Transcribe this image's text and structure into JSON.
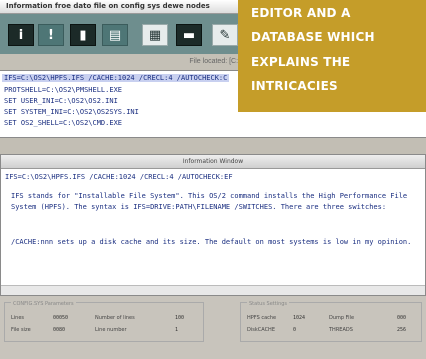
{
  "window": {
    "title": "Information froe dato file on config sys dewe nodes"
  },
  "toolbar": {
    "buttons": [
      {
        "icon": "info-icon",
        "glyph": "i"
      },
      {
        "icon": "exclamation-icon",
        "glyph": "!"
      },
      {
        "icon": "page-arrow-icon",
        "glyph": "▮"
      },
      {
        "icon": "clipboard-icon",
        "glyph": "▤"
      },
      {
        "icon": "grid-icon",
        "glyph": "▦"
      },
      {
        "icon": "list-icon",
        "glyph": "▬"
      },
      {
        "icon": "edit-icon",
        "glyph": "✎"
      }
    ]
  },
  "location": {
    "label": "File located: [C:\\"
  },
  "file_pane": {
    "lines": [
      "IFS=C:\\OS2\\HPFS.IFS /CACHE:1024 /CRECL:4 /AUTOCHECK:C",
      "PROTSHELL=C:\\OS2\\PMSHELL.EXE",
      "SET USER_INI=C:\\OS2\\OS2.INI",
      "SET SYSTEM_INI=C:\\OS2\\OS2SYS.INI",
      "SET OS2_SHELL=C:\\OS2\\CMD.EXE"
    ]
  },
  "info": {
    "title": "Information Window",
    "path": "IFS=C:\\OS2\\HPFS.IFS /CACHE:1024 /CRECL:4 /AUTOCHECK:EF",
    "paragraphs": [
      "IFS stands for \"Installable File System\". This OS/2 command installs the High Performance File System (HPFS). The syntax is IFS=DRIVE:PATH\\FILENAME /SWITCHES. There are three switches:",
      "/CACHE:nnn sets up a disk cache and its size. The default on most systems is low in my opinion."
    ]
  },
  "status": {
    "group1": {
      "title": "CONFIG.SYS Parameters",
      "fields": [
        {
          "label": "Lines",
          "value": "00050"
        },
        {
          "label": "Number of lines",
          "value": "100"
        },
        {
          "label": "File size",
          "value": "0080"
        },
        {
          "label": "Line number",
          "value": "1"
        }
      ]
    },
    "group2": {
      "title": "Status Settings",
      "fields": [
        {
          "label": "HPFS cache",
          "value": "1024"
        },
        {
          "label": "DiskCACHE",
          "value": "0"
        },
        {
          "label": "Dump File",
          "value": "000"
        },
        {
          "label": "THREADS",
          "value": "256"
        }
      ]
    }
  },
  "overlay": {
    "lines": [
      "EDITOR AND A",
      "DATABASE WHICH",
      "EXPLAINS THE",
      "INTRICACIES"
    ]
  }
}
